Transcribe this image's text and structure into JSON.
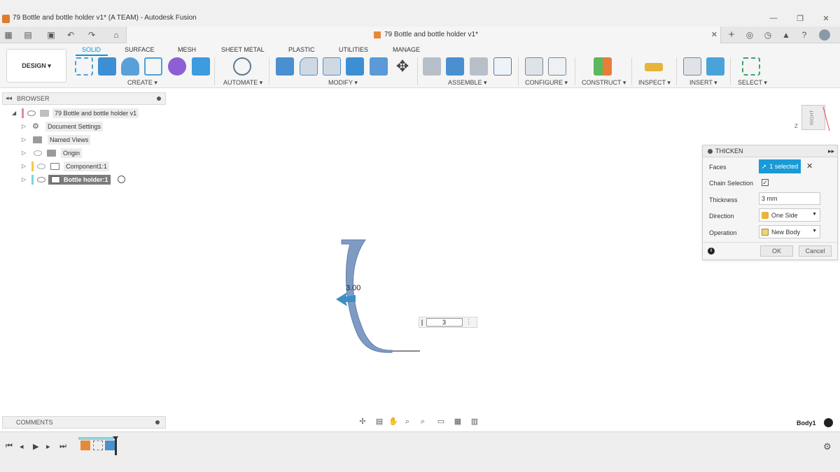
{
  "window": {
    "title": "79 Bottle and bottle holder v1* (A TEAM) - Autodesk Fusion",
    "controls": [
      "—",
      "❐",
      "✕"
    ]
  },
  "document_tab": {
    "title": "79 Bottle and bottle holder v1*",
    "close": "✕"
  },
  "toolbar": {
    "design_button": "DESIGN ▾",
    "workspace_tabs": [
      "SOLID",
      "SURFACE",
      "MESH",
      "SHEET METAL",
      "PLASTIC",
      "UTILITIES",
      "MANAGE"
    ],
    "active_tab": "SOLID",
    "groups": [
      "CREATE ▾",
      "AUTOMATE ▾",
      "MODIFY ▾",
      "ASSEMBLE ▾",
      "CONFIGURE ▾",
      "CONSTRUCT ▾",
      "INSPECT ▾",
      "INSERT ▾",
      "SELECT ▾"
    ]
  },
  "browser": {
    "header": "BROWSER",
    "items": [
      {
        "label": "79 Bottle and bottle holder v1",
        "icon": "document-icon"
      },
      {
        "label": "Document Settings",
        "icon": "gear-icon"
      },
      {
        "label": "Named Views",
        "icon": "folder-icon"
      },
      {
        "label": "Origin",
        "icon": "folder-icon"
      },
      {
        "label": "Component1:1",
        "icon": "component-icon"
      },
      {
        "label": "Bottle holder:1",
        "icon": "component-icon"
      }
    ]
  },
  "viewcube": {
    "face": "RIGHT",
    "axis": "Z"
  },
  "thicken": {
    "title": "THICKEN",
    "faces_label": "Faces",
    "faces_value": "1 selected",
    "chain_label": "Chain Selection",
    "chain_checked": "✓",
    "thickness_label": "Thickness",
    "thickness_value": "3 mm",
    "direction_label": "Direction",
    "direction_value": "One Side",
    "operation_label": "Operation",
    "operation_value": "New Body",
    "ok": "OK",
    "cancel": "Cancel"
  },
  "canvas": {
    "dimension_label": "3.00",
    "inline_value": "3"
  },
  "comments": {
    "header": "COMMENTS"
  },
  "status": {
    "body_label": "Body1"
  },
  "colors": {
    "accent": "#0696d7",
    "selection": "#1a9ad6",
    "geometry": "#7f9bc4"
  }
}
